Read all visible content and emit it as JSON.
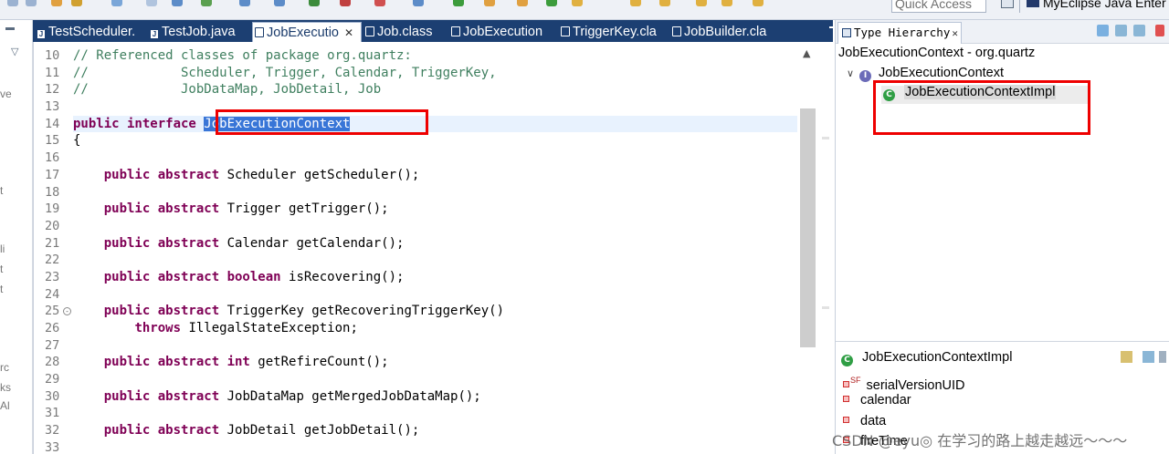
{
  "toolbar": {
    "quick_access_placeholder": "Quick Access",
    "perspective_label": "MyEclipse Java Enter"
  },
  "left_rail": {
    "fragments": [
      "ve",
      "t",
      "li",
      "t",
      "t",
      "rc",
      "ks",
      "Al"
    ]
  },
  "editor": {
    "tabs": [
      {
        "label": "TestScheduler.",
        "icon": "java-file-icon"
      },
      {
        "label": "TestJob.java",
        "icon": "java-file-icon"
      },
      {
        "label": "JobExecutio",
        "icon": "class-file-icon",
        "active": true
      },
      {
        "label": "Job.class",
        "icon": "class-file-icon"
      },
      {
        "label": "JobExecution",
        "icon": "class-file-icon"
      },
      {
        "label": "TriggerKey.cla",
        "icon": "class-file-icon"
      },
      {
        "label": "JobBuilder.cla",
        "icon": "class-file-icon"
      }
    ],
    "close_glyph": "✕",
    "line_numbers": [
      "10",
      "11",
      "12",
      "13",
      "14",
      "15",
      "16",
      "17",
      "18",
      "19",
      "20",
      "21",
      "22",
      "23",
      "24",
      "25",
      "26",
      "27",
      "28",
      "29",
      "30",
      "31",
      "32",
      "33"
    ],
    "lines": {
      "l10": "// Referenced classes of package org.quartz:",
      "l11": "//            Scheduler, Trigger, Calendar, TriggerKey,",
      "l12": "//            JobDataMap, JobDetail, Job",
      "l14_kw": "public interface",
      "l14_name": "JobExecutionContext",
      "l15": "{",
      "l17_kw": "public abstract",
      "l17_rest": " Scheduler getScheduler();",
      "l19_kw": "public abstract",
      "l19_rest": " Trigger getTrigger();",
      "l21_kw": "public abstract",
      "l21_rest": " Calendar getCalendar();",
      "l23_kw": "public abstract boolean",
      "l23_rest": " isRecovering();",
      "l25_kw": "public abstract",
      "l25_rest": " TriggerKey getRecoveringTriggerKey()",
      "l26_kw": "throws",
      "l26_rest": " IllegalStateException;",
      "l28_kw": "public abstract int",
      "l28_rest": " getRefireCount();",
      "l30_kw": "public abstract",
      "l30_rest": " JobDataMap getMergedJobDataMap();",
      "l32_kw": "public abstract",
      "l32_rest": " JobDetail getJobDetail();"
    }
  },
  "type_hierarchy": {
    "tab_label": "Type Hierarchy",
    "title": "JobExecutionContext - org.quartz",
    "tree": {
      "root": "JobExecutionContext",
      "child": "JobExecutionContextImpl"
    },
    "members_header": "JobExecutionContextImpl",
    "members": [
      "serialVersionUID",
      "calendar",
      "data",
      "fireTime"
    ],
    "static_final_marker": "SF"
  },
  "watermark": "CSDN @eyu◎ 在学习的路上越走越远～～～",
  "colors": {
    "tab_bar": "#1c3f72",
    "keyword": "#7f0055",
    "comment": "#3f7f5f",
    "selection": "#3875d7",
    "highlight_box": "#ee0000"
  }
}
